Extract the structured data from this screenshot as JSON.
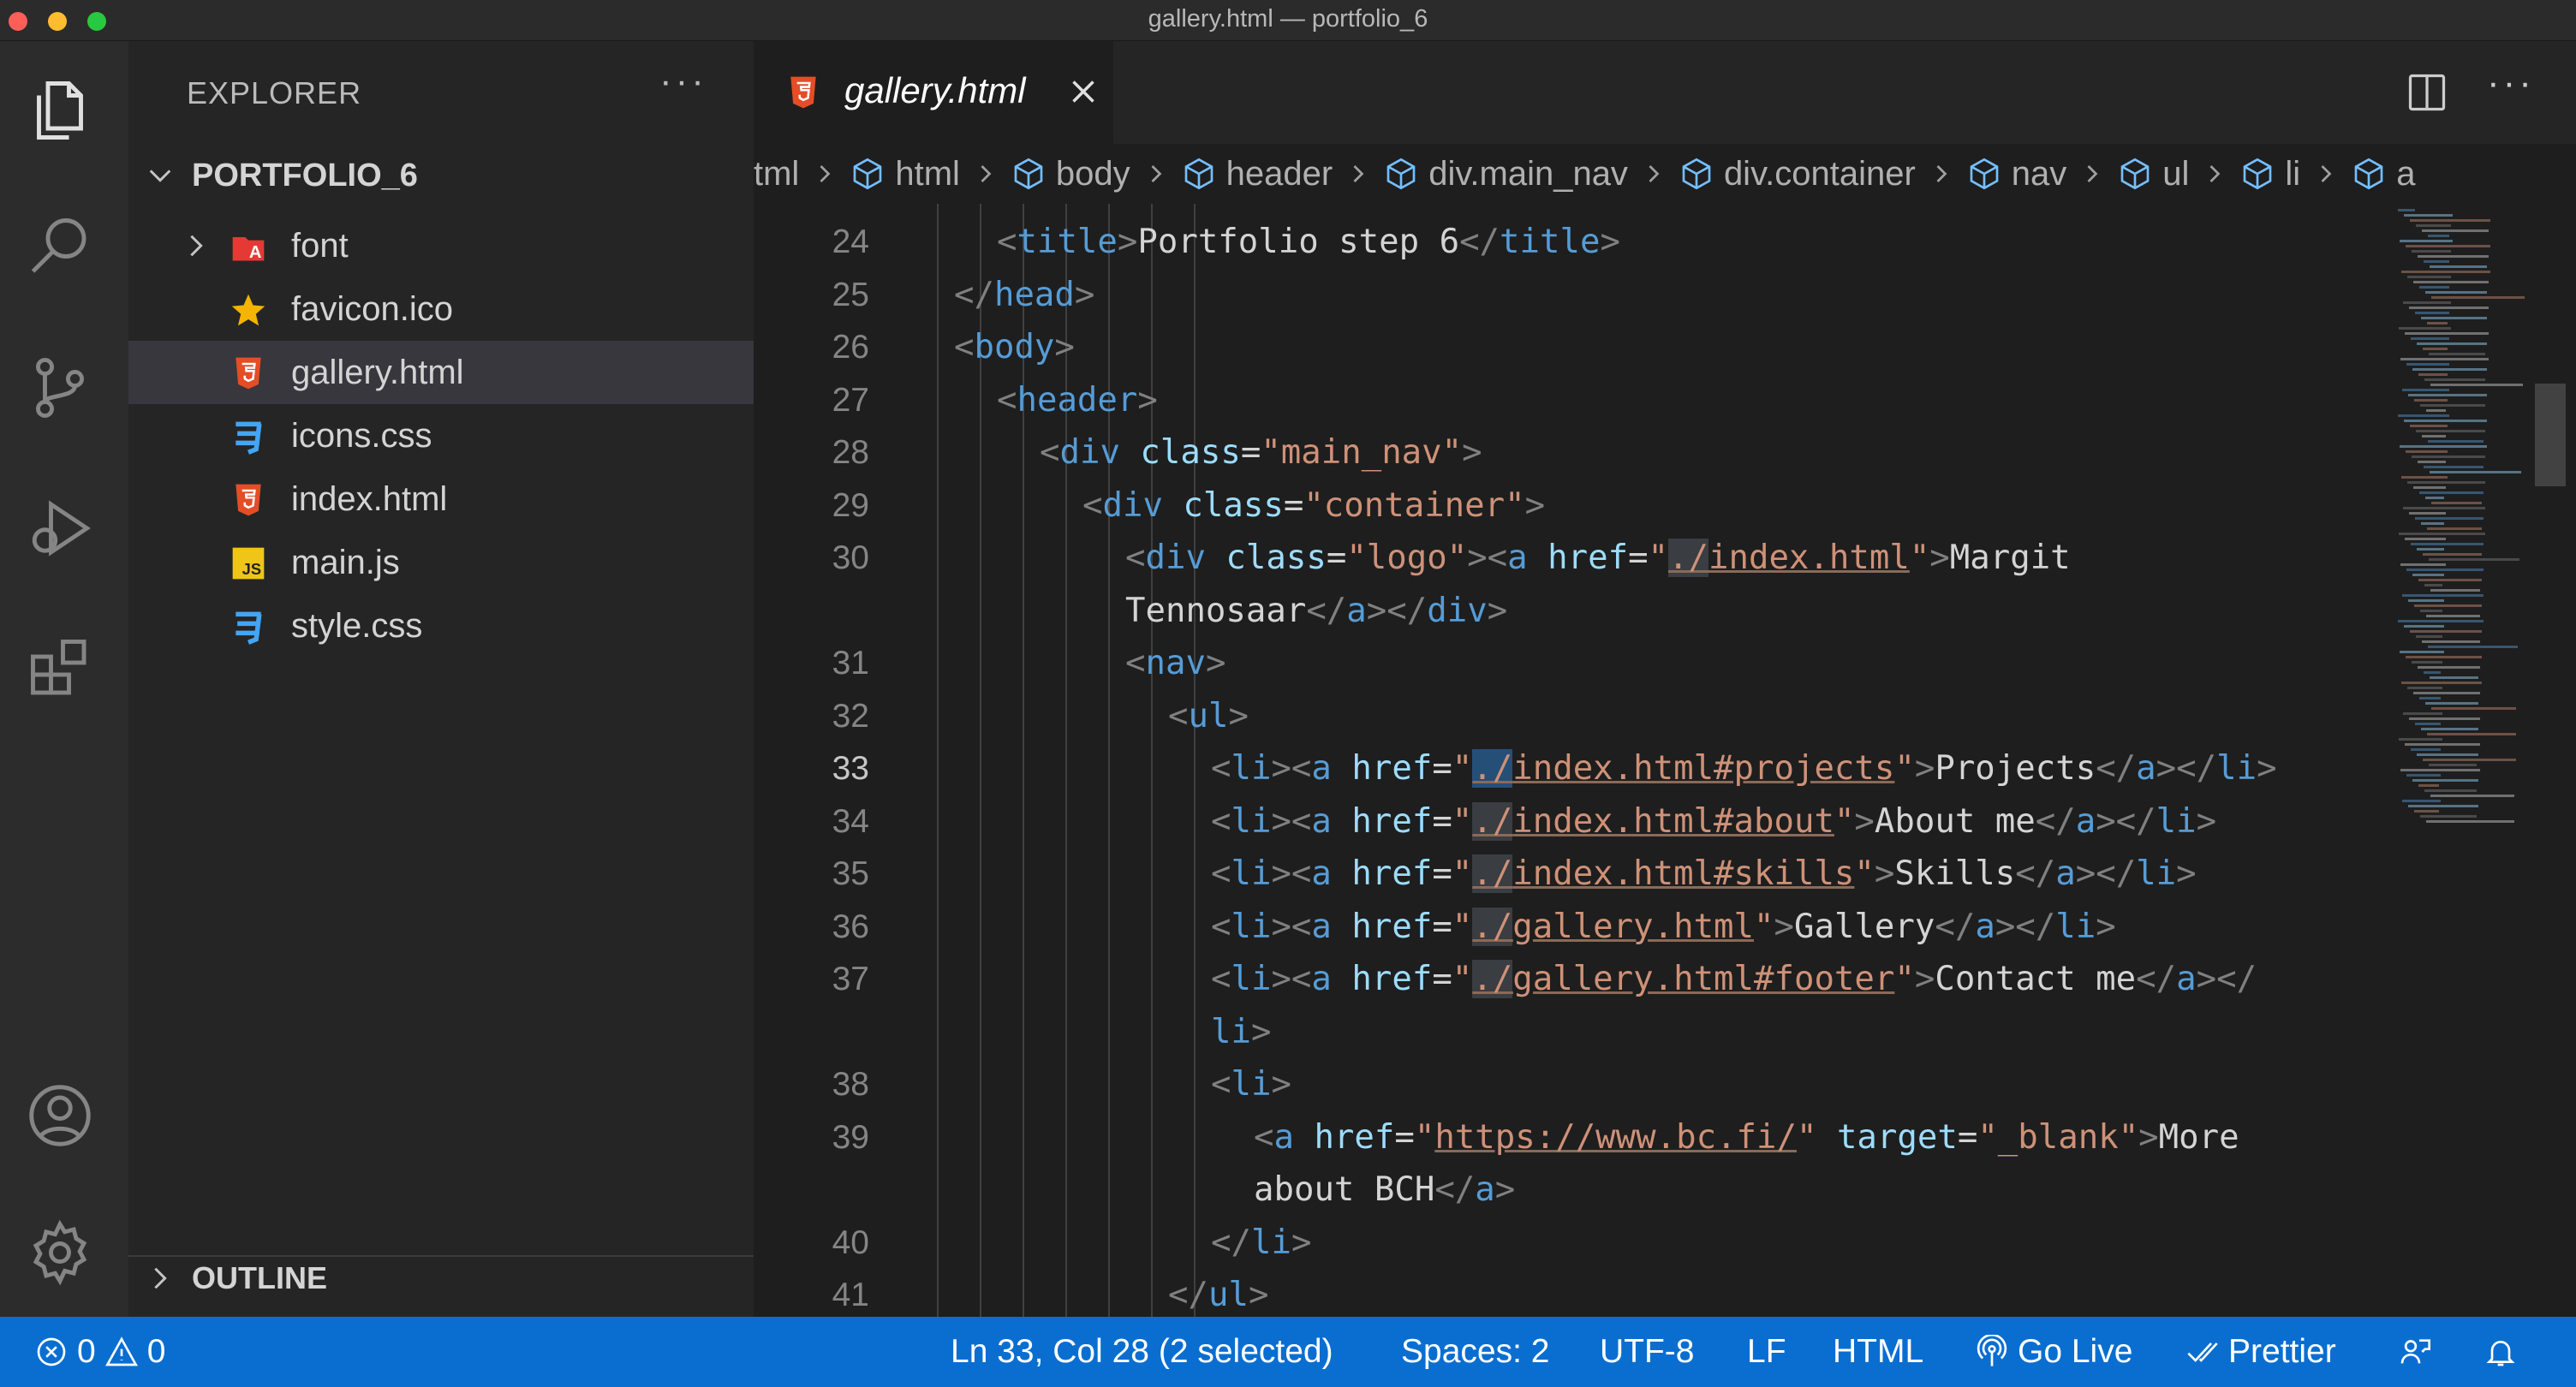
{
  "window": {
    "title": "gallery.html — portfolio_6"
  },
  "sidebar": {
    "title": "EXPLORER",
    "more": "···",
    "folder": "PORTFOLIO_6",
    "files": [
      {
        "label": "font",
        "icon": "font-folder-icon",
        "has_chevron": true,
        "active": false
      },
      {
        "label": "favicon.ico",
        "icon": "star-icon",
        "has_chevron": false,
        "active": false
      },
      {
        "label": "gallery.html",
        "icon": "html5-icon",
        "has_chevron": false,
        "active": true
      },
      {
        "label": "icons.css",
        "icon": "css3-icon",
        "has_chevron": false,
        "active": false
      },
      {
        "label": "index.html",
        "icon": "html5-icon",
        "has_chevron": false,
        "active": false
      },
      {
        "label": "main.js",
        "icon": "js-icon",
        "has_chevron": false,
        "active": false
      },
      {
        "label": "style.css",
        "icon": "css3-icon",
        "has_chevron": false,
        "active": false
      }
    ],
    "outline": "OUTLINE"
  },
  "editor": {
    "tab": {
      "label": "gallery.html"
    },
    "more": "···",
    "breadcrumb": [
      {
        "label": "tml",
        "cube": false
      },
      {
        "label": "html",
        "cube": true
      },
      {
        "label": "body",
        "cube": true
      },
      {
        "label": "header",
        "cube": true
      },
      {
        "label": "div.main_nav",
        "cube": true
      },
      {
        "label": "div.container",
        "cube": true
      },
      {
        "label": "nav",
        "cube": true
      },
      {
        "label": "ul",
        "cube": true
      },
      {
        "label": "li",
        "cube": true
      },
      {
        "label": "a",
        "cube": true
      }
    ],
    "current_line": "33",
    "lines": [
      {
        "n": "24",
        "indent": 1,
        "tokens": [
          [
            "punc",
            "<"
          ],
          [
            "tag",
            "title"
          ],
          [
            "punc",
            ">"
          ],
          [
            "text",
            "Portfolio step 6"
          ],
          [
            "punc",
            "</"
          ],
          [
            "tag",
            "title"
          ],
          [
            "punc",
            ">"
          ]
        ]
      },
      {
        "n": "25",
        "indent": 0,
        "tokens": [
          [
            "punc",
            "</"
          ],
          [
            "tag",
            "head"
          ],
          [
            "punc",
            ">"
          ]
        ]
      },
      {
        "n": "26",
        "indent": 0,
        "tokens": [
          [
            "punc",
            "<"
          ],
          [
            "tag",
            "body"
          ],
          [
            "punc",
            ">"
          ]
        ]
      },
      {
        "n": "27",
        "indent": 1,
        "tokens": [
          [
            "punc",
            "<"
          ],
          [
            "tag",
            "header"
          ],
          [
            "punc",
            ">"
          ]
        ]
      },
      {
        "n": "28",
        "indent": 2,
        "tokens": [
          [
            "punc",
            "<"
          ],
          [
            "tag",
            "div"
          ],
          [
            "text",
            " "
          ],
          [
            "attr",
            "class"
          ],
          [
            "text",
            "="
          ],
          [
            "str",
            "\"main_nav\""
          ],
          [
            "punc",
            ">"
          ]
        ]
      },
      {
        "n": "29",
        "indent": 3,
        "tokens": [
          [
            "punc",
            "<"
          ],
          [
            "tag",
            "div"
          ],
          [
            "text",
            " "
          ],
          [
            "attr",
            "class"
          ],
          [
            "text",
            "="
          ],
          [
            "str",
            "\"container\""
          ],
          [
            "punc",
            ">"
          ]
        ]
      },
      {
        "n": "30",
        "indent": 4,
        "tokens": [
          [
            "punc",
            "<"
          ],
          [
            "tag",
            "div"
          ],
          [
            "text",
            " "
          ],
          [
            "attr",
            "class"
          ],
          [
            "text",
            "="
          ],
          [
            "str",
            "\"logo\""
          ],
          [
            "punc",
            "><"
          ],
          [
            "tag",
            "a"
          ],
          [
            "text",
            " "
          ],
          [
            "attr",
            "href"
          ],
          [
            "text",
            "="
          ],
          [
            "str",
            "\""
          ],
          [
            "strhl",
            "./"
          ],
          [
            "stru",
            "index.html"
          ],
          [
            "str",
            "\""
          ],
          [
            "punc",
            ">"
          ],
          [
            "text",
            "Margit"
          ]
        ]
      },
      {
        "n": "",
        "indent": 4,
        "tokens": [
          [
            "text",
            "Tennosaar"
          ],
          [
            "punc",
            "</"
          ],
          [
            "tag",
            "a"
          ],
          [
            "punc",
            "></"
          ],
          [
            "tag",
            "div"
          ],
          [
            "punc",
            ">"
          ]
        ]
      },
      {
        "n": "31",
        "indent": 4,
        "tokens": [
          [
            "punc",
            "<"
          ],
          [
            "tag",
            "nav"
          ],
          [
            "punc",
            ">"
          ]
        ]
      },
      {
        "n": "32",
        "indent": 5,
        "tokens": [
          [
            "punc",
            "<"
          ],
          [
            "tag",
            "ul"
          ],
          [
            "punc",
            ">"
          ]
        ]
      },
      {
        "n": "33",
        "indent": 6,
        "tokens": [
          [
            "punc",
            "<"
          ],
          [
            "tag",
            "li"
          ],
          [
            "punc",
            "><"
          ],
          [
            "tag",
            "a"
          ],
          [
            "text",
            " "
          ],
          [
            "attr",
            "href"
          ],
          [
            "text",
            "="
          ],
          [
            "str",
            "\""
          ],
          [
            "strsel",
            "./"
          ],
          [
            "stru",
            "index.html#projects"
          ],
          [
            "str",
            "\""
          ],
          [
            "punc",
            ">"
          ],
          [
            "text",
            "Projects"
          ],
          [
            "punc",
            "</"
          ],
          [
            "tag",
            "a"
          ],
          [
            "punc",
            "></"
          ],
          [
            "tag",
            "li"
          ],
          [
            "punc",
            ">"
          ]
        ]
      },
      {
        "n": "34",
        "indent": 6,
        "tokens": [
          [
            "punc",
            "<"
          ],
          [
            "tag",
            "li"
          ],
          [
            "punc",
            "><"
          ],
          [
            "tag",
            "a"
          ],
          [
            "text",
            " "
          ],
          [
            "attr",
            "href"
          ],
          [
            "text",
            "="
          ],
          [
            "str",
            "\""
          ],
          [
            "strhl",
            "./"
          ],
          [
            "stru",
            "index.html#about"
          ],
          [
            "str",
            "\""
          ],
          [
            "punc",
            ">"
          ],
          [
            "text",
            "About me"
          ],
          [
            "punc",
            "</"
          ],
          [
            "tag",
            "a"
          ],
          [
            "punc",
            "></"
          ],
          [
            "tag",
            "li"
          ],
          [
            "punc",
            ">"
          ]
        ]
      },
      {
        "n": "35",
        "indent": 6,
        "tokens": [
          [
            "punc",
            "<"
          ],
          [
            "tag",
            "li"
          ],
          [
            "punc",
            "><"
          ],
          [
            "tag",
            "a"
          ],
          [
            "text",
            " "
          ],
          [
            "attr",
            "href"
          ],
          [
            "text",
            "="
          ],
          [
            "str",
            "\""
          ],
          [
            "strhl",
            "./"
          ],
          [
            "stru",
            "index.html#skills"
          ],
          [
            "str",
            "\""
          ],
          [
            "punc",
            ">"
          ],
          [
            "text",
            "Skills"
          ],
          [
            "punc",
            "</"
          ],
          [
            "tag",
            "a"
          ],
          [
            "punc",
            "></"
          ],
          [
            "tag",
            "li"
          ],
          [
            "punc",
            ">"
          ]
        ]
      },
      {
        "n": "36",
        "indent": 6,
        "tokens": [
          [
            "punc",
            "<"
          ],
          [
            "tag",
            "li"
          ],
          [
            "punc",
            "><"
          ],
          [
            "tag",
            "a"
          ],
          [
            "text",
            " "
          ],
          [
            "attr",
            "href"
          ],
          [
            "text",
            "="
          ],
          [
            "str",
            "\""
          ],
          [
            "strhl",
            "./"
          ],
          [
            "stru",
            "gallery.html"
          ],
          [
            "str",
            "\""
          ],
          [
            "punc",
            ">"
          ],
          [
            "text",
            "Gallery"
          ],
          [
            "punc",
            "</"
          ],
          [
            "tag",
            "a"
          ],
          [
            "punc",
            "></"
          ],
          [
            "tag",
            "li"
          ],
          [
            "punc",
            ">"
          ]
        ]
      },
      {
        "n": "37",
        "indent": 6,
        "tokens": [
          [
            "punc",
            "<"
          ],
          [
            "tag",
            "li"
          ],
          [
            "punc",
            "><"
          ],
          [
            "tag",
            "a"
          ],
          [
            "text",
            " "
          ],
          [
            "attr",
            "href"
          ],
          [
            "text",
            "="
          ],
          [
            "str",
            "\""
          ],
          [
            "strhl",
            "./"
          ],
          [
            "stru",
            "gallery.html#footer"
          ],
          [
            "str",
            "\""
          ],
          [
            "punc",
            ">"
          ],
          [
            "text",
            "Contact me"
          ],
          [
            "punc",
            "</"
          ],
          [
            "tag",
            "a"
          ],
          [
            "punc",
            "></"
          ]
        ]
      },
      {
        "n": "",
        "indent": 6,
        "tokens": [
          [
            "tag",
            "li"
          ],
          [
            "punc",
            ">"
          ]
        ]
      },
      {
        "n": "38",
        "indent": 6,
        "tokens": [
          [
            "punc",
            "<"
          ],
          [
            "tag",
            "li"
          ],
          [
            "punc",
            ">"
          ]
        ]
      },
      {
        "n": "39",
        "indent": 7,
        "tokens": [
          [
            "punc",
            "<"
          ],
          [
            "tag",
            "a"
          ],
          [
            "text",
            " "
          ],
          [
            "attr",
            "href"
          ],
          [
            "text",
            "="
          ],
          [
            "str",
            "\""
          ],
          [
            "stru",
            "https://www.bc.fi/"
          ],
          [
            "str",
            "\""
          ],
          [
            "text",
            " "
          ],
          [
            "attr",
            "target"
          ],
          [
            "text",
            "="
          ],
          [
            "str",
            "\"_blank\""
          ],
          [
            "punc",
            ">"
          ],
          [
            "text",
            "More"
          ]
        ]
      },
      {
        "n": "",
        "indent": 7,
        "tokens": [
          [
            "text",
            "about BCH"
          ],
          [
            "punc",
            "</"
          ],
          [
            "tag",
            "a"
          ],
          [
            "punc",
            ">"
          ]
        ]
      },
      {
        "n": "40",
        "indent": 6,
        "tokens": [
          [
            "punc",
            "</"
          ],
          [
            "tag",
            "li"
          ],
          [
            "punc",
            ">"
          ]
        ]
      },
      {
        "n": "41",
        "indent": 5,
        "tokens": [
          [
            "punc",
            "</"
          ],
          [
            "tag",
            "ul"
          ],
          [
            "punc",
            ">"
          ]
        ]
      }
    ]
  },
  "statusbar": {
    "errors": "0",
    "warnings": "0",
    "position": "Ln 33, Col 28 (2 selected)",
    "spaces": "Spaces: 2",
    "encoding": "UTF-8",
    "eol": "LF",
    "language": "HTML",
    "golive": "Go Live",
    "prettier": "Prettier"
  },
  "colors": {
    "statusbar": "#0a6ed1",
    "tag": "#569cd6",
    "attr": "#9cdcfe",
    "string": "#ce9178",
    "html_icon": "#e44d26",
    "css_icon": "#42a5f5",
    "js_icon": "#f0c419"
  }
}
